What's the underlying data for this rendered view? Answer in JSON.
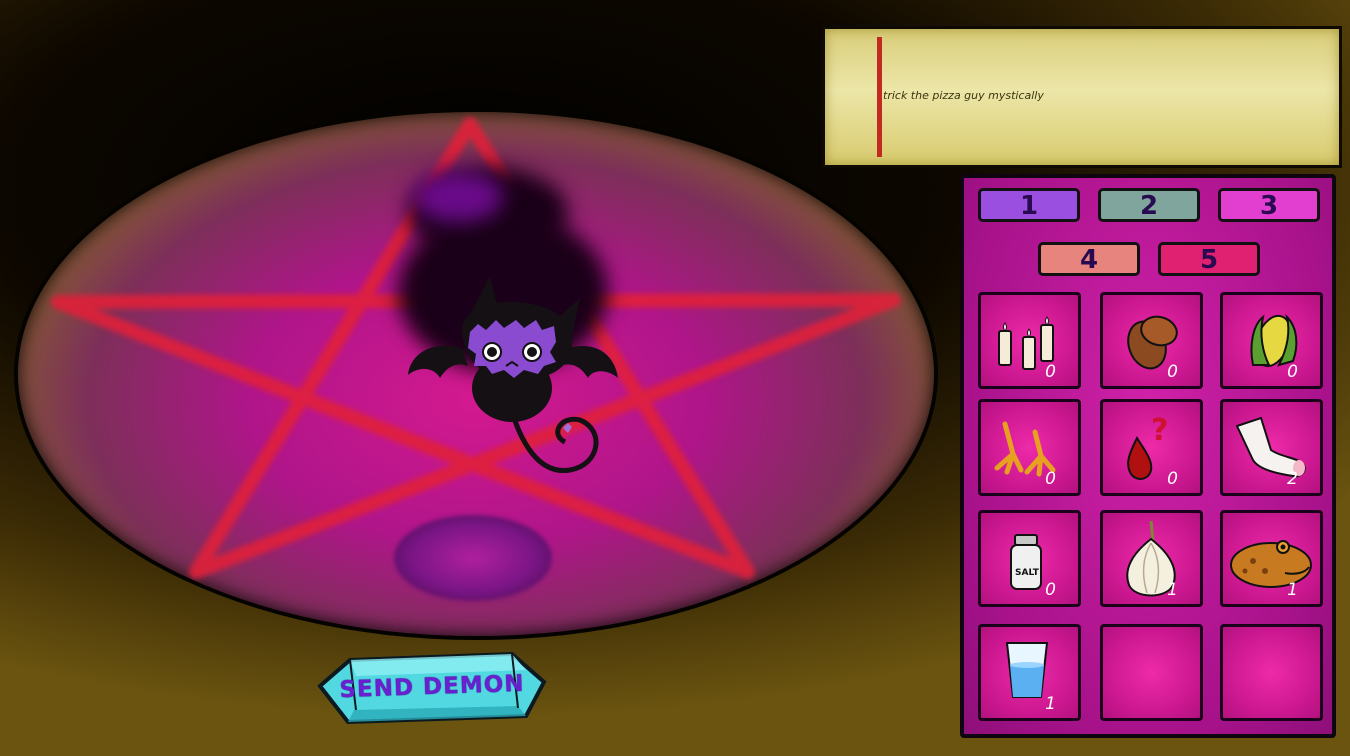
{
  "task": {
    "text": "trick the pizza guy mystically"
  },
  "send_button": {
    "label": "SEND DEMON"
  },
  "tabs": [
    {
      "label": "1",
      "color": "#9b4fe0"
    },
    {
      "label": "2",
      "color": "#7fa59c"
    },
    {
      "label": "3",
      "color": "#e23ed0"
    },
    {
      "label": "4",
      "color": "#e8847e"
    },
    {
      "label": "5",
      "color": "#e02070"
    }
  ],
  "inventory": [
    {
      "item": "candles-icon",
      "count": "0"
    },
    {
      "item": "beans-icon",
      "count": "0"
    },
    {
      "item": "corn-icon",
      "count": "0"
    },
    {
      "item": "chicken-feet-icon",
      "count": "0"
    },
    {
      "item": "mystery-blood-icon",
      "count": "0"
    },
    {
      "item": "sock-icon",
      "count": "2"
    },
    {
      "item": "salt-icon",
      "count": "0"
    },
    {
      "item": "onion-icon",
      "count": "1"
    },
    {
      "item": "toad-icon",
      "count": "1"
    },
    {
      "item": "water-glass-icon",
      "count": "1"
    },
    {
      "item": "empty",
      "count": ""
    },
    {
      "item": "empty",
      "count": ""
    }
  ],
  "colors": {
    "pentagram": "#e0203a",
    "circle": "#c01690",
    "demon": "#8a4bd0"
  }
}
